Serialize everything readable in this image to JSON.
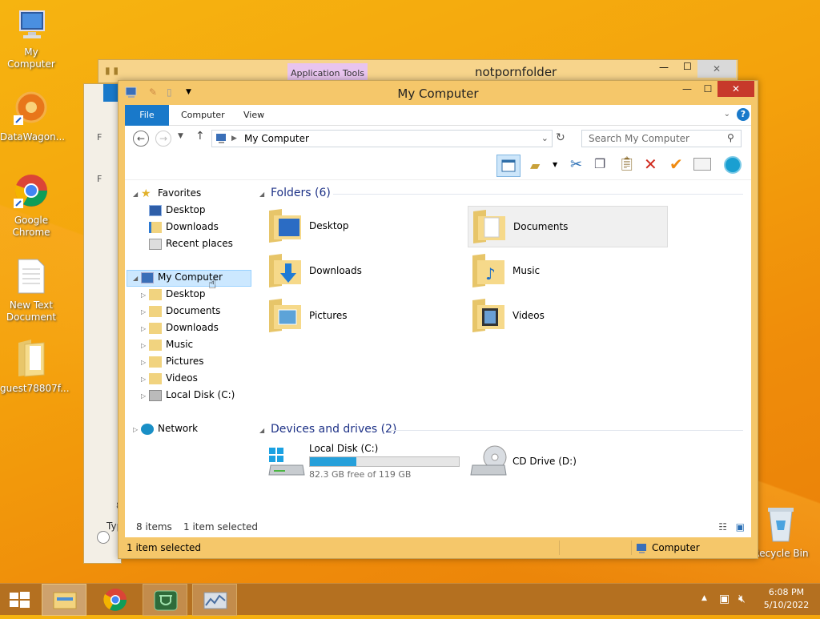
{
  "desktop": {
    "icons": [
      {
        "label": "My Computer"
      },
      {
        "label": "DataWagon..."
      },
      {
        "label": "Google Chrome"
      },
      {
        "label": "New Text Document"
      },
      {
        "label": "guest78807f..."
      },
      {
        "label": "Recycle Bin"
      }
    ]
  },
  "back_window": {
    "title": "notpornfolder",
    "context_tab": "Application Tools",
    "left_glyphs": [
      "F",
      "F",
      "8",
      "Typ"
    ]
  },
  "window": {
    "title": "My Computer",
    "tabs": {
      "file": "File",
      "computer": "Computer",
      "view": "View"
    },
    "address": "My Computer",
    "search_placeholder": "Search My Computer",
    "nav": {
      "favorites": "Favorites",
      "fav_items": [
        "Desktop",
        "Downloads",
        "Recent places"
      ],
      "my_computer": "My Computer",
      "pc_items": [
        "Desktop",
        "Documents",
        "Downloads",
        "Music",
        "Pictures",
        "Videos",
        "Local Disk (C:)"
      ],
      "network": "Network"
    },
    "folders_header": "Folders (6)",
    "folders": [
      "Desktop",
      "Documents",
      "Downloads",
      "Music",
      "Pictures",
      "Videos"
    ],
    "devices_header": "Devices and drives (2)",
    "drive_c": {
      "name": "Local Disk (C:)",
      "free": "82.3 GB free of 119 GB",
      "used_fraction": 0.31
    },
    "drive_d": {
      "name": "CD Drive (D:)"
    },
    "status_items": "8 items",
    "status_selected": "1 item selected",
    "footer_selected": "1 item selected",
    "footer_location": "Computer"
  },
  "taskbar": {
    "time": "6:08 PM",
    "date": "5/10/2022"
  },
  "colors": {
    "accent": "#1979ca",
    "window_frame": "#f5c76a",
    "taskbar": "#b47020",
    "drive_bar": "#26a0da"
  }
}
